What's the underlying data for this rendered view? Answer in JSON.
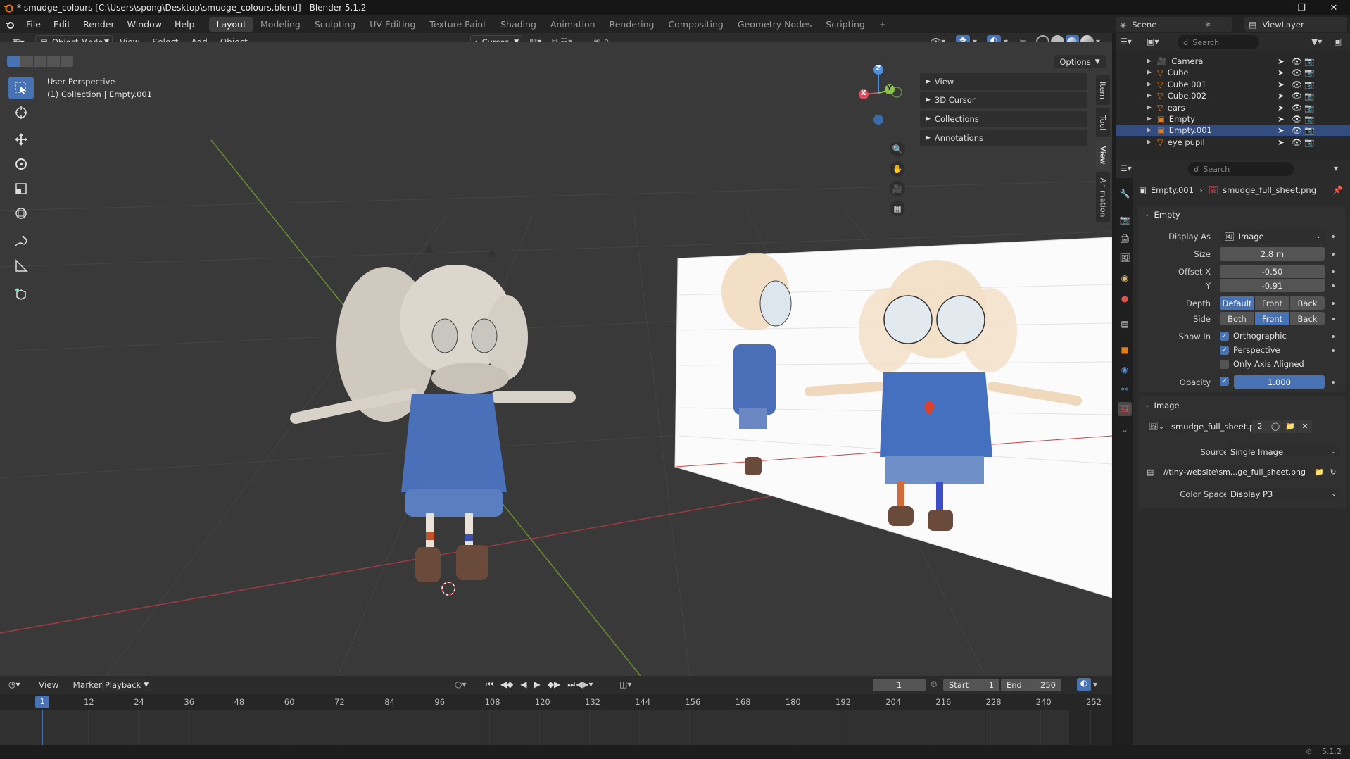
{
  "window": {
    "title": "* smudge_colours [C:\\Users\\spong\\Desktop\\smudge_colours.blend] - Blender 5.1.2",
    "controls": [
      "minimize",
      "maximize",
      "close"
    ]
  },
  "menubar": {
    "menus": [
      "File",
      "Edit",
      "Render",
      "Window",
      "Help"
    ],
    "workspaces": [
      "Layout",
      "Modeling",
      "Sculpting",
      "UV Editing",
      "Texture Paint",
      "Shading",
      "Animation",
      "Rendering",
      "Compositing",
      "Geometry Nodes",
      "Scripting"
    ],
    "active_workspace": "Layout",
    "add_tab": "+",
    "scene_name": "Scene",
    "view_layer_name": "ViewLayer"
  },
  "viewport_header": {
    "mode": "Object Mode",
    "menus": [
      "View",
      "Select",
      "Add",
      "Object"
    ],
    "pivot": "Cursor"
  },
  "viewport": {
    "perspective_label": "User Perspective",
    "collection_label": "(1) Collection | Empty.001",
    "options_label": "Options",
    "gizmo_axes": {
      "z": "Z",
      "y": "Y",
      "x": "X"
    },
    "tools": [
      "select-box",
      "cursor",
      "move",
      "rotate",
      "scale",
      "transform",
      "annotate",
      "measure",
      "add-cube"
    ]
  },
  "npanel": {
    "sections": [
      "View",
      "3D Cursor",
      "Collections",
      "Annotations"
    ],
    "tabs": [
      "Item",
      "Tool",
      "View",
      "Animation"
    ],
    "active_tab": "View"
  },
  "outliner": {
    "search_placeholder": "Search",
    "items": [
      {
        "name": "Camera",
        "type": "camera"
      },
      {
        "name": "Cube",
        "type": "mesh"
      },
      {
        "name": "Cube.001",
        "type": "mesh"
      },
      {
        "name": "Cube.002",
        "type": "mesh"
      },
      {
        "name": "ears",
        "type": "mesh"
      },
      {
        "name": "Empty",
        "type": "empty"
      },
      {
        "name": "Empty.001",
        "type": "empty",
        "selected": true
      },
      {
        "name": "eye pupil",
        "type": "mesh"
      }
    ]
  },
  "properties": {
    "search_placeholder": "Search",
    "breadcrumb_object": "Empty.001",
    "breadcrumb_data": "smudge_full_sheet.png",
    "empty_panel": {
      "title": "Empty",
      "display_as_label": "Display As",
      "display_as_value": "Image",
      "size_label": "Size",
      "size_value": "2.8 m",
      "offset_x_label": "Offset X",
      "offset_x_value": "-0.50",
      "offset_y_label": "Y",
      "offset_y_value": "-0.91",
      "depth_label": "Depth",
      "depth_options": [
        "Default",
        "Front",
        "Back"
      ],
      "depth_selected": "Default",
      "side_label": "Side",
      "side_options": [
        "Both",
        "Front",
        "Back"
      ],
      "side_selected": "Front",
      "show_in_label": "Show In",
      "show_orthographic": "Orthographic",
      "show_perspective": "Perspective",
      "only_axis_aligned": "Only Axis Aligned",
      "opacity_label": "Opacity",
      "opacity_value": "1.000"
    },
    "image_panel": {
      "title": "Image",
      "image_name": "smudge_full_sheet.png",
      "users": "2",
      "source_label": "Source",
      "source_value": "Single Image",
      "filepath": "//tiny-website\\sm...ge_full_sheet.png",
      "color_space_label": "Color Space",
      "color_space_value": "Display P3"
    }
  },
  "timeline": {
    "menus": [
      "View",
      "Marker",
      "Playback"
    ],
    "current_frame": "1",
    "start_label": "Start",
    "start_value": "1",
    "end_label": "End",
    "end_value": "250",
    "ruler_labels": [
      "12",
      "24",
      "36",
      "48",
      "60",
      "72",
      "84",
      "96",
      "108",
      "120",
      "132",
      "144",
      "156",
      "168",
      "180",
      "192",
      "204",
      "216",
      "228",
      "240",
      "252"
    ],
    "playhead_label": "1"
  },
  "statusbar": {
    "version": "5.1.2"
  },
  "colors": {
    "accent": "#4772b3",
    "selected_row": "#334d80",
    "viewport_bg": "#393939",
    "x_axis": "#d94f5c",
    "y_axis": "#8bc34a",
    "z_axis": "#4f8fd9"
  }
}
